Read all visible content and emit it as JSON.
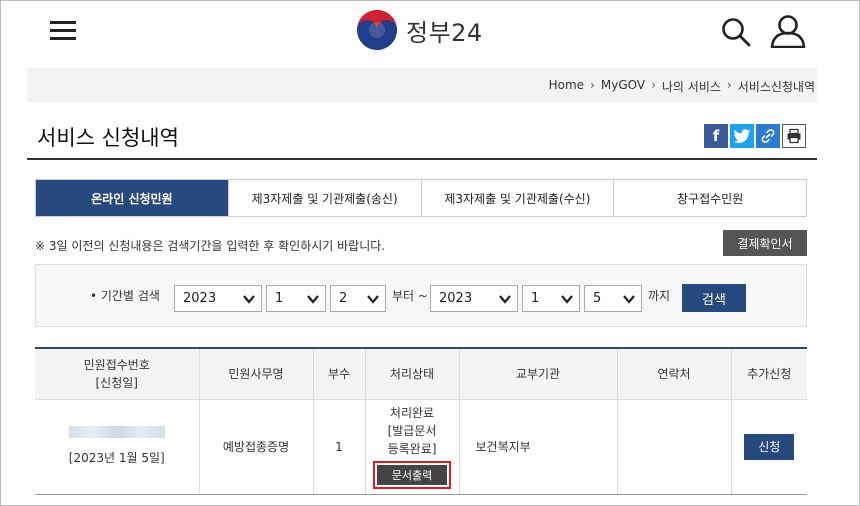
{
  "header": {
    "logo_text": "정부24",
    "menu_icon": "hamburger-menu-icon",
    "search_icon": "search-icon",
    "user_icon": "user-icon"
  },
  "breadcrumb": [
    "Home",
    "MyGOV",
    "나의 서비스",
    "서비스신청내역"
  ],
  "page": {
    "title": "서비스 신청내역"
  },
  "share": {
    "facebook": "f",
    "twitter": "twitter-icon",
    "link": "link-icon",
    "print": "print-icon"
  },
  "tabs": [
    {
      "label": "온라인 신청민원",
      "active": true
    },
    {
      "label": "제3자제출 및 기관제출(송신)",
      "active": false
    },
    {
      "label": "제3자제출 및 기관제출(수신)",
      "active": false
    },
    {
      "label": "창구접수민원",
      "active": false
    }
  ],
  "notice": "※ 3일 이전의 신청내용은 검색기간을 입력한 후 확인하시기 바랍니다.",
  "payment_button": "결제확인서",
  "search": {
    "label": "• 기간별 검색",
    "start_year": "2023",
    "start_month": "1",
    "start_day": "2",
    "from_text": "부터 ~",
    "end_year": "2023",
    "end_month": "1",
    "end_day": "5",
    "until_text": "까지",
    "button": "검색"
  },
  "table": {
    "headers": [
      "민원접수번호\n[신청일]",
      "민원사무명",
      "부수",
      "처리상태",
      "교부기관",
      "연락처",
      "추가신청"
    ],
    "header_line1": "민원접수번호",
    "header_line2": "[신청일]",
    "rows": [
      {
        "date": "[2023년 1월 5일]",
        "service": "예방접종증명",
        "copies": "1",
        "status_line1": "처리완료",
        "status_line2": "[발급문서",
        "status_line3": "등록완료]",
        "print_button": "문서출력",
        "agency": "보건복지부",
        "contact": "",
        "apply_button": "신청"
      }
    ]
  },
  "colors": {
    "primary": "#264a7e",
    "highlight": "#e01b1b",
    "dark_button": "#555555"
  }
}
